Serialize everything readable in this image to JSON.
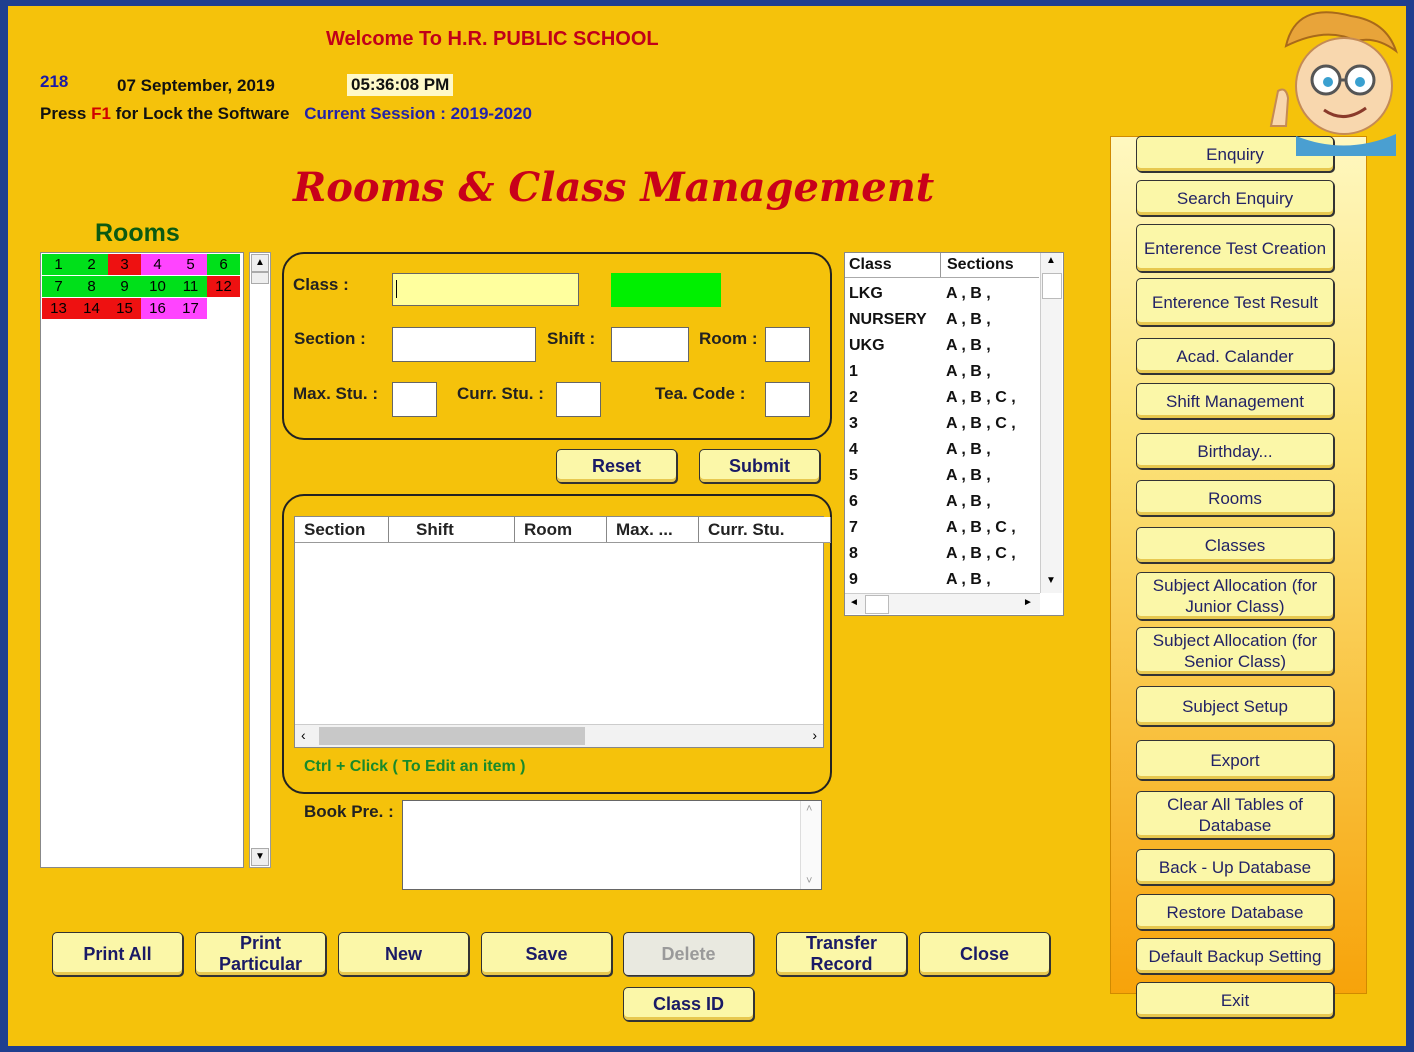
{
  "header": {
    "welcome": "Welcome To  H.R. PUBLIC SCHOOL",
    "counter": "218",
    "date": "07 September, 2019",
    "time": "05:36:08 PM",
    "press_prefix": "Press",
    "press_key": "F1",
    "press_suffix": "for Lock the Software",
    "session": "Current Session : 2019-2020"
  },
  "title": "Rooms & Class Management",
  "rooms": {
    "heading": "Rooms",
    "cells": [
      {
        "label": "1",
        "color": "#00e01a"
      },
      {
        "label": "2",
        "color": "#00e01a"
      },
      {
        "label": "3",
        "color": "#ee1111"
      },
      {
        "label": "4",
        "color": "#ff44ff"
      },
      {
        "label": "5",
        "color": "#ff44ff"
      },
      {
        "label": "6",
        "color": "#00e01a"
      },
      {
        "label": "7",
        "color": "#00e01a"
      },
      {
        "label": "8",
        "color": "#00e01a"
      },
      {
        "label": "9",
        "color": "#00e01a"
      },
      {
        "label": "10",
        "color": "#00e01a"
      },
      {
        "label": "11",
        "color": "#00e01a"
      },
      {
        "label": "12",
        "color": "#ee1111"
      },
      {
        "label": "13",
        "color": "#ee1111"
      },
      {
        "label": "14",
        "color": "#ee1111"
      },
      {
        "label": "15",
        "color": "#ee1111"
      },
      {
        "label": "16",
        "color": "#ff44ff"
      },
      {
        "label": "17",
        "color": "#ff44ff"
      }
    ]
  },
  "form": {
    "class_label": "Class :",
    "section_label": "Section :",
    "shift_label": "Shift :",
    "room_label": "Room :",
    "maxstu_label": "Max. Stu. :",
    "currstu_label": "Curr. Stu. :",
    "teacode_label": "Tea. Code :",
    "class_value": "",
    "status_color": "#00f000",
    "reset": "Reset",
    "submit": "Submit"
  },
  "grid": {
    "columns": [
      "Section",
      "Shift",
      "Room",
      "Max. ...",
      "Curr. Stu."
    ],
    "hint": "Ctrl + Click ( To Edit an item )"
  },
  "book_pre_label": "Book Pre. :",
  "class_list": {
    "headers": [
      "Class",
      "Sections"
    ],
    "rows": [
      [
        "LKG",
        "A , B ,"
      ],
      [
        "NURSERY",
        "A , B ,"
      ],
      [
        "UKG",
        "A , B ,"
      ],
      [
        "1",
        "A , B ,"
      ],
      [
        "2",
        "A , B , C ,"
      ],
      [
        "3",
        "A , B , C ,"
      ],
      [
        "4",
        "A , B ,"
      ],
      [
        "5",
        "A , B ,"
      ],
      [
        "6",
        "A , B ,"
      ],
      [
        "7",
        "A , B , C ,"
      ],
      [
        "8",
        "A , B , C ,"
      ],
      [
        "9",
        "A , B ,"
      ]
    ]
  },
  "bottom": {
    "print_all": "Print All",
    "print_particular": "Print Particular",
    "new": "New",
    "save": "Save",
    "delete": "Delete",
    "transfer": "Transfer Record",
    "close": "Close",
    "class_id": "Class ID"
  },
  "side_menu": [
    "Enquiry",
    "Search Enquiry",
    "Enterence Test Creation",
    "Enterence Test Result",
    "Acad. Calander",
    "Shift Management",
    "Birthday...",
    "Rooms",
    "Classes",
    "Subject Allocation (for Junior Class)",
    "Subject Allocation (for Senior Class)",
    "Subject Setup",
    "Export",
    "Clear All Tables of Database",
    "Back - Up Database",
    "Restore Database",
    "Default Backup Setting",
    "Exit"
  ]
}
